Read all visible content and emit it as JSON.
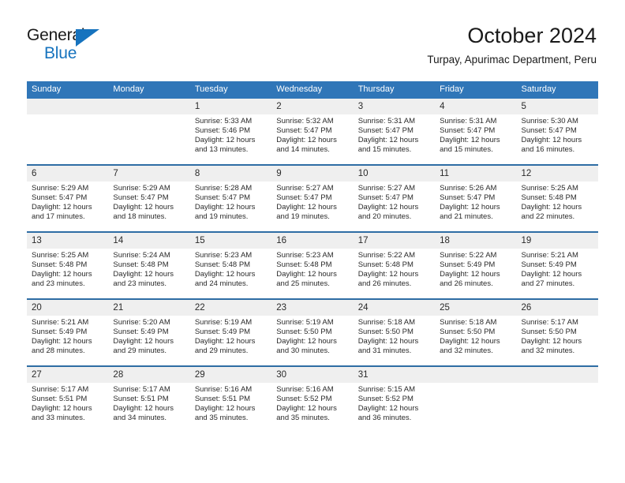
{
  "brand": {
    "name_top": "General",
    "name_bottom": "Blue",
    "triangle_color": "#1673be",
    "top_color": "#1a1a1a"
  },
  "header": {
    "title": "October 2024",
    "subtitle": "Turpay, Apurimac Department, Peru"
  },
  "colors": {
    "header_blue": "#3076b8",
    "row_separator_blue": "#2e6da4",
    "daynum_band": "#efefef",
    "text": "#2a2a2a"
  },
  "weekday_headers": [
    "Sunday",
    "Monday",
    "Tuesday",
    "Wednesday",
    "Thursday",
    "Friday",
    "Saturday"
  ],
  "weeks": [
    [
      {
        "day": "",
        "sunrise": "",
        "sunset": "",
        "daylight_1": "",
        "daylight_2": ""
      },
      {
        "day": "",
        "sunrise": "",
        "sunset": "",
        "daylight_1": "",
        "daylight_2": ""
      },
      {
        "day": "1",
        "sunrise": "Sunrise: 5:33 AM",
        "sunset": "Sunset: 5:46 PM",
        "daylight_1": "Daylight: 12 hours",
        "daylight_2": "and 13 minutes."
      },
      {
        "day": "2",
        "sunrise": "Sunrise: 5:32 AM",
        "sunset": "Sunset: 5:47 PM",
        "daylight_1": "Daylight: 12 hours",
        "daylight_2": "and 14 minutes."
      },
      {
        "day": "3",
        "sunrise": "Sunrise: 5:31 AM",
        "sunset": "Sunset: 5:47 PM",
        "daylight_1": "Daylight: 12 hours",
        "daylight_2": "and 15 minutes."
      },
      {
        "day": "4",
        "sunrise": "Sunrise: 5:31 AM",
        "sunset": "Sunset: 5:47 PM",
        "daylight_1": "Daylight: 12 hours",
        "daylight_2": "and 15 minutes."
      },
      {
        "day": "5",
        "sunrise": "Sunrise: 5:30 AM",
        "sunset": "Sunset: 5:47 PM",
        "daylight_1": "Daylight: 12 hours",
        "daylight_2": "and 16 minutes."
      }
    ],
    [
      {
        "day": "6",
        "sunrise": "Sunrise: 5:29 AM",
        "sunset": "Sunset: 5:47 PM",
        "daylight_1": "Daylight: 12 hours",
        "daylight_2": "and 17 minutes."
      },
      {
        "day": "7",
        "sunrise": "Sunrise: 5:29 AM",
        "sunset": "Sunset: 5:47 PM",
        "daylight_1": "Daylight: 12 hours",
        "daylight_2": "and 18 minutes."
      },
      {
        "day": "8",
        "sunrise": "Sunrise: 5:28 AM",
        "sunset": "Sunset: 5:47 PM",
        "daylight_1": "Daylight: 12 hours",
        "daylight_2": "and 19 minutes."
      },
      {
        "day": "9",
        "sunrise": "Sunrise: 5:27 AM",
        "sunset": "Sunset: 5:47 PM",
        "daylight_1": "Daylight: 12 hours",
        "daylight_2": "and 19 minutes."
      },
      {
        "day": "10",
        "sunrise": "Sunrise: 5:27 AM",
        "sunset": "Sunset: 5:47 PM",
        "daylight_1": "Daylight: 12 hours",
        "daylight_2": "and 20 minutes."
      },
      {
        "day": "11",
        "sunrise": "Sunrise: 5:26 AM",
        "sunset": "Sunset: 5:47 PM",
        "daylight_1": "Daylight: 12 hours",
        "daylight_2": "and 21 minutes."
      },
      {
        "day": "12",
        "sunrise": "Sunrise: 5:25 AM",
        "sunset": "Sunset: 5:48 PM",
        "daylight_1": "Daylight: 12 hours",
        "daylight_2": "and 22 minutes."
      }
    ],
    [
      {
        "day": "13",
        "sunrise": "Sunrise: 5:25 AM",
        "sunset": "Sunset: 5:48 PM",
        "daylight_1": "Daylight: 12 hours",
        "daylight_2": "and 23 minutes."
      },
      {
        "day": "14",
        "sunrise": "Sunrise: 5:24 AM",
        "sunset": "Sunset: 5:48 PM",
        "daylight_1": "Daylight: 12 hours",
        "daylight_2": "and 23 minutes."
      },
      {
        "day": "15",
        "sunrise": "Sunrise: 5:23 AM",
        "sunset": "Sunset: 5:48 PM",
        "daylight_1": "Daylight: 12 hours",
        "daylight_2": "and 24 minutes."
      },
      {
        "day": "16",
        "sunrise": "Sunrise: 5:23 AM",
        "sunset": "Sunset: 5:48 PM",
        "daylight_1": "Daylight: 12 hours",
        "daylight_2": "and 25 minutes."
      },
      {
        "day": "17",
        "sunrise": "Sunrise: 5:22 AM",
        "sunset": "Sunset: 5:48 PM",
        "daylight_1": "Daylight: 12 hours",
        "daylight_2": "and 26 minutes."
      },
      {
        "day": "18",
        "sunrise": "Sunrise: 5:22 AM",
        "sunset": "Sunset: 5:49 PM",
        "daylight_1": "Daylight: 12 hours",
        "daylight_2": "and 26 minutes."
      },
      {
        "day": "19",
        "sunrise": "Sunrise: 5:21 AM",
        "sunset": "Sunset: 5:49 PM",
        "daylight_1": "Daylight: 12 hours",
        "daylight_2": "and 27 minutes."
      }
    ],
    [
      {
        "day": "20",
        "sunrise": "Sunrise: 5:21 AM",
        "sunset": "Sunset: 5:49 PM",
        "daylight_1": "Daylight: 12 hours",
        "daylight_2": "and 28 minutes."
      },
      {
        "day": "21",
        "sunrise": "Sunrise: 5:20 AM",
        "sunset": "Sunset: 5:49 PM",
        "daylight_1": "Daylight: 12 hours",
        "daylight_2": "and 29 minutes."
      },
      {
        "day": "22",
        "sunrise": "Sunrise: 5:19 AM",
        "sunset": "Sunset: 5:49 PM",
        "daylight_1": "Daylight: 12 hours",
        "daylight_2": "and 29 minutes."
      },
      {
        "day": "23",
        "sunrise": "Sunrise: 5:19 AM",
        "sunset": "Sunset: 5:50 PM",
        "daylight_1": "Daylight: 12 hours",
        "daylight_2": "and 30 minutes."
      },
      {
        "day": "24",
        "sunrise": "Sunrise: 5:18 AM",
        "sunset": "Sunset: 5:50 PM",
        "daylight_1": "Daylight: 12 hours",
        "daylight_2": "and 31 minutes."
      },
      {
        "day": "25",
        "sunrise": "Sunrise: 5:18 AM",
        "sunset": "Sunset: 5:50 PM",
        "daylight_1": "Daylight: 12 hours",
        "daylight_2": "and 32 minutes."
      },
      {
        "day": "26",
        "sunrise": "Sunrise: 5:17 AM",
        "sunset": "Sunset: 5:50 PM",
        "daylight_1": "Daylight: 12 hours",
        "daylight_2": "and 32 minutes."
      }
    ],
    [
      {
        "day": "27",
        "sunrise": "Sunrise: 5:17 AM",
        "sunset": "Sunset: 5:51 PM",
        "daylight_1": "Daylight: 12 hours",
        "daylight_2": "and 33 minutes."
      },
      {
        "day": "28",
        "sunrise": "Sunrise: 5:17 AM",
        "sunset": "Sunset: 5:51 PM",
        "daylight_1": "Daylight: 12 hours",
        "daylight_2": "and 34 minutes."
      },
      {
        "day": "29",
        "sunrise": "Sunrise: 5:16 AM",
        "sunset": "Sunset: 5:51 PM",
        "daylight_1": "Daylight: 12 hours",
        "daylight_2": "and 35 minutes."
      },
      {
        "day": "30",
        "sunrise": "Sunrise: 5:16 AM",
        "sunset": "Sunset: 5:52 PM",
        "daylight_1": "Daylight: 12 hours",
        "daylight_2": "and 35 minutes."
      },
      {
        "day": "31",
        "sunrise": "Sunrise: 5:15 AM",
        "sunset": "Sunset: 5:52 PM",
        "daylight_1": "Daylight: 12 hours",
        "daylight_2": "and 36 minutes."
      },
      {
        "day": "",
        "sunrise": "",
        "sunset": "",
        "daylight_1": "",
        "daylight_2": ""
      },
      {
        "day": "",
        "sunrise": "",
        "sunset": "",
        "daylight_1": "",
        "daylight_2": ""
      }
    ]
  ]
}
